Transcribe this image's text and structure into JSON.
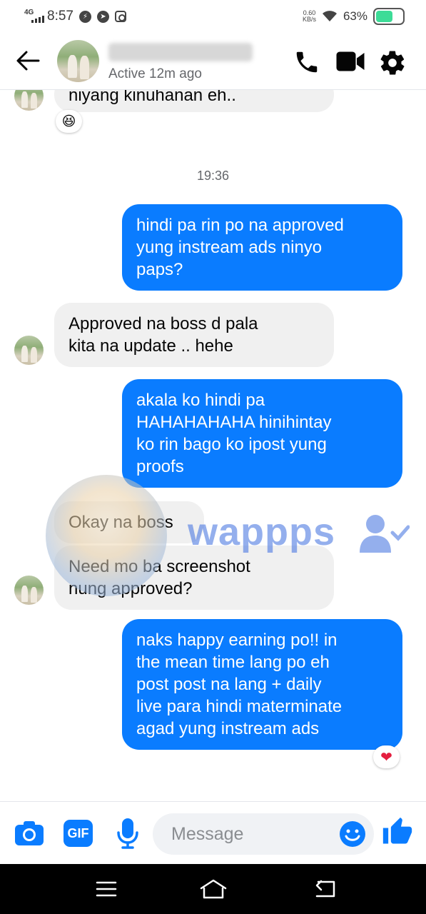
{
  "status_bar": {
    "network": "4G",
    "time": "8:57",
    "speed_value": "0.60",
    "speed_unit": "KB/s",
    "battery": "63%",
    "battery_level": 0.63
  },
  "header": {
    "active_status": "Active 12m ago"
  },
  "messages": {
    "m0": {
      "text": "niyang kinuhanan eh..",
      "reaction": "😆"
    },
    "timestamp": "19:36",
    "m1": {
      "lines": [
        "hindi pa rin po na approved",
        "yung instream ads ninyo",
        "paps?"
      ]
    },
    "m2": {
      "lines": [
        "Approved na boss d pala",
        "kita na update .. hehe"
      ]
    },
    "m3": {
      "lines": [
        "akala ko hindi pa",
        "HAHAHAHAHA hinihintay",
        "ko rin bago ko ipost yung",
        "proofs"
      ]
    },
    "m4": {
      "text": "Okay na boss"
    },
    "m5": {
      "lines": [
        "Need mo ba screenshot",
        "nung approved?"
      ]
    },
    "m6": {
      "lines": [
        "naks happy earning po!! in",
        "the mean time lang po eh",
        "post post na lang + daily",
        "live para hindi materminate",
        "agad yung instream ads"
      ],
      "reaction": "❤"
    }
  },
  "watermark": {
    "text": "wappps"
  },
  "composer": {
    "placeholder": "Message",
    "gif_label": "GIF"
  },
  "colors": {
    "accent": "#0a7cff",
    "incoming_bubble": "#f0f0f0",
    "battery": "#3ddc97"
  },
  "icons": {
    "header": [
      "back-arrow-icon",
      "phone-icon",
      "video-camera-icon",
      "gear-icon"
    ],
    "composer": [
      "camera-icon",
      "gif-icon",
      "microphone-icon",
      "emoji-icon",
      "thumbs-up-icon"
    ],
    "navbar": [
      "menu-icon",
      "home-icon",
      "back-icon"
    ]
  }
}
